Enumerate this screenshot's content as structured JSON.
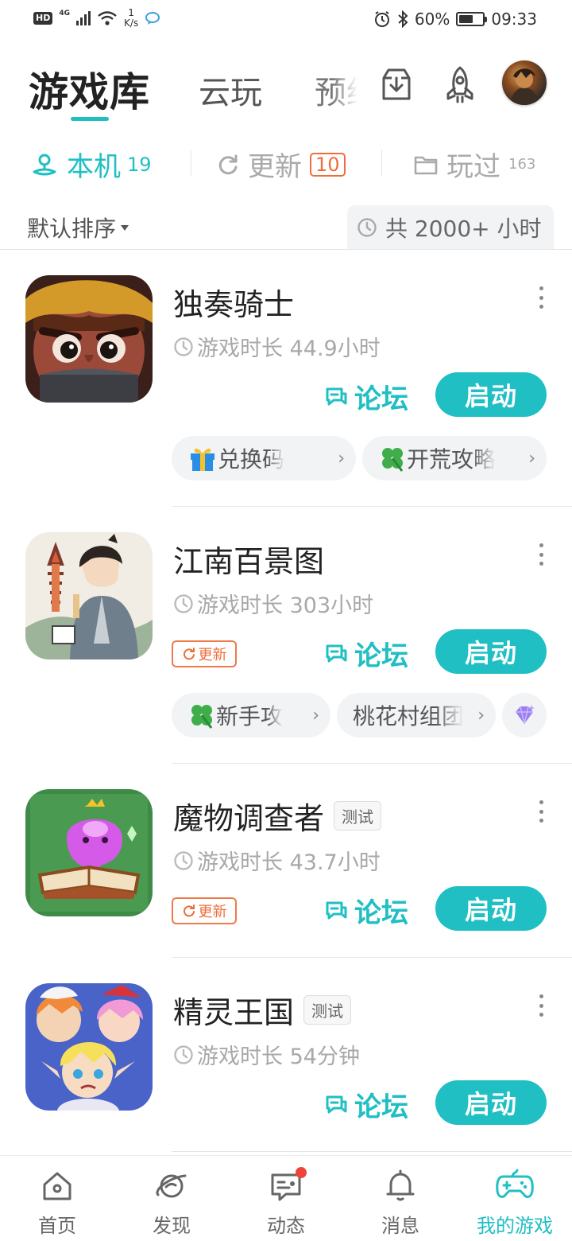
{
  "status_bar": {
    "hd": "HD",
    "network": "4G",
    "speed_value": "1",
    "speed_unit": "K/s",
    "battery": "60%",
    "battery_level": 0.6,
    "time": "09:33"
  },
  "header": {
    "tab_library": "游戏库",
    "tab_cloud": "云玩",
    "tab_reserve": "预约"
  },
  "filters": {
    "local": {
      "label": "本机",
      "count": "19"
    },
    "update": {
      "label": "更新",
      "count": "10"
    },
    "played": {
      "label": "玩过",
      "count": "163"
    }
  },
  "sort": {
    "label": "默认排序",
    "total_time": "共 2000+ 小时"
  },
  "games": [
    {
      "name": "独奏骑士",
      "playtime": "游戏时长 44.9小时",
      "forum": "论坛",
      "start": "启动",
      "chips": [
        {
          "label": "兑换码"
        },
        {
          "label": "开荒攻略"
        }
      ]
    },
    {
      "name": "江南百景图",
      "playtime": "游戏时长 303小时",
      "update_tag": "更新",
      "forum": "论坛",
      "start": "启动",
      "chips": [
        {
          "label": "新手攻"
        },
        {
          "label": "桃花村组团"
        }
      ]
    },
    {
      "name": "魔物调查者",
      "test_tag": "测试",
      "playtime": "游戏时长 43.7小时",
      "update_tag": "更新",
      "forum": "论坛",
      "start": "启动"
    },
    {
      "name": "精灵王国",
      "test_tag": "测试",
      "playtime": "游戏时长 54分钟",
      "forum": "论坛",
      "start": "启动"
    }
  ],
  "bottom_nav": {
    "home": "首页",
    "discover": "发现",
    "feed": "动态",
    "messages": "消息",
    "my_games": "我的游戏"
  },
  "colors": {
    "accent": "#1fbfc4",
    "update_orange": "#ee6e3b",
    "badge_red": "#f0443a"
  }
}
